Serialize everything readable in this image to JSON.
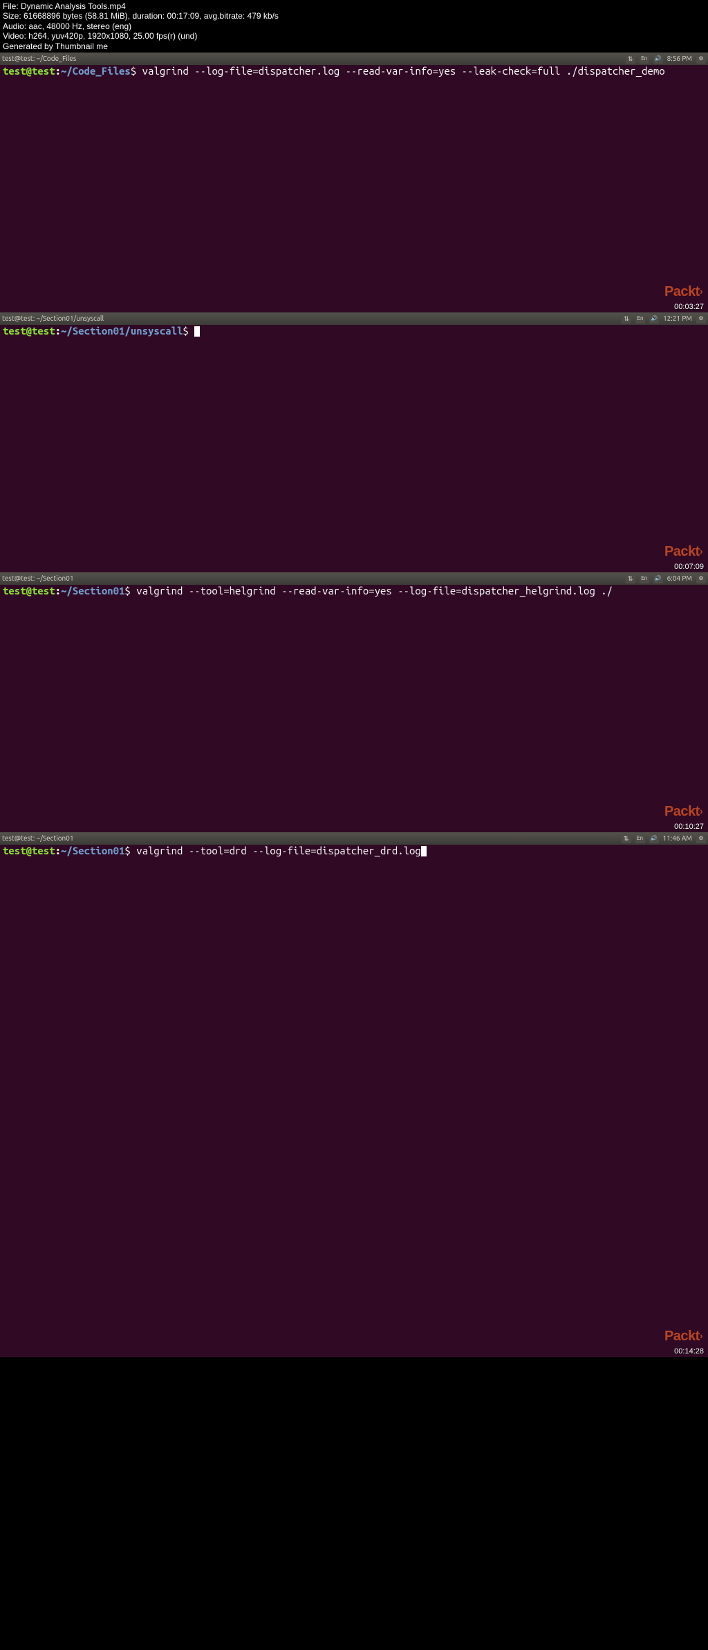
{
  "header": {
    "line1": "File: Dynamic Analysis Tools.mp4",
    "line2": "Size: 61668896 bytes (58.81 MiB), duration: 00:17:09, avg.bitrate: 479 kb/s",
    "line3": "Audio: aac, 48000 Hz, stereo (eng)",
    "line4": "Video: h264, yuv420p, 1920x1080, 25.00 fps(r) (und)",
    "line5": "Generated by Thumbnail me"
  },
  "watermark": "Packt",
  "panes": [
    {
      "title": "test@test: ~/Code_Files",
      "time": "8:56 PM",
      "timestamp": "00:03:27",
      "user": "test@test",
      "path": "~/Code_Files",
      "cmd": "valgrind --log-file=dispatcher.log --read-var-info=yes --leak-check=full ./dispatcher_demo",
      "cursor": false
    },
    {
      "title": "test@test: ~/Section01/unsyscall",
      "time": "12:21 PM",
      "timestamp": "00:07:09",
      "user": "test@test",
      "path": "~/Section01/unsyscall",
      "cmd": "",
      "cursor": true
    },
    {
      "title": "test@test: ~/Section01",
      "time": "6:04 PM",
      "timestamp": "00:10:27",
      "user": "test@test",
      "path": "~/Section01",
      "cmd": "valgrind --tool=helgrind --read-var-info=yes --log-file=dispatcher_helgrind.log ./",
      "cursor": false
    },
    {
      "title": "test@test: ~/Section01",
      "time": "11:46 AM",
      "timestamp": "00:14:28",
      "user": "test@test",
      "path": "~/Section01",
      "cmd": "valgrind --tool=drd --log-file=dispatcher_drd.log",
      "cursor": true
    }
  ],
  "tray": {
    "lang": "En"
  }
}
